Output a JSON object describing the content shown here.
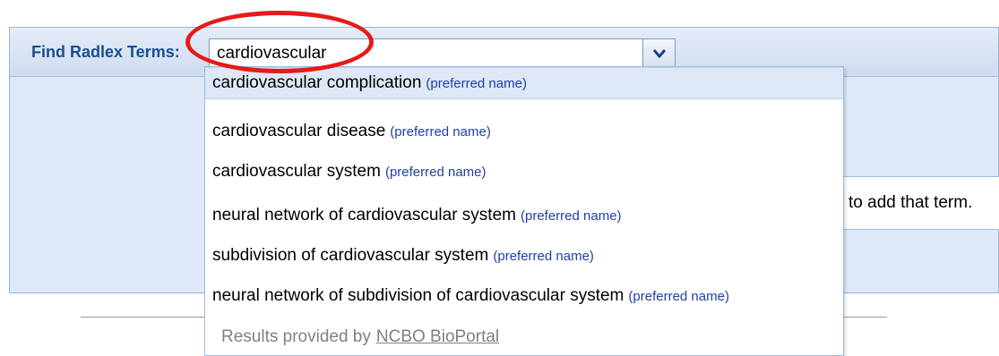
{
  "search": {
    "label": "Find Radlex Terms:",
    "value": "cardiovascular"
  },
  "instruction_text": "to add that term.",
  "results": [
    {
      "term": "cardiovascular complication",
      "tag": "(preferred name)"
    },
    {
      "term": "cardiovascular disease",
      "tag": "(preferred name)"
    },
    {
      "term": "cardiovascular system",
      "tag": "(preferred name)"
    },
    {
      "term": "neural network of cardiovascular system",
      "tag": "(preferred name)"
    },
    {
      "term": "subdivision of cardiovascular system",
      "tag": "(preferred name)"
    },
    {
      "term": "neural network of subdivision of cardiovascular system",
      "tag": "(preferred name)"
    }
  ],
  "footer": {
    "prefix": "Results provided by",
    "link": "NCBO BioPortal"
  },
  "icons": {
    "trigger": "chevron-down-icon"
  },
  "colors": {
    "highlight": "#e41b1b",
    "label": "#1a4f8f",
    "tag": "#1f3fa6",
    "selected_row": "#dde7f5"
  }
}
